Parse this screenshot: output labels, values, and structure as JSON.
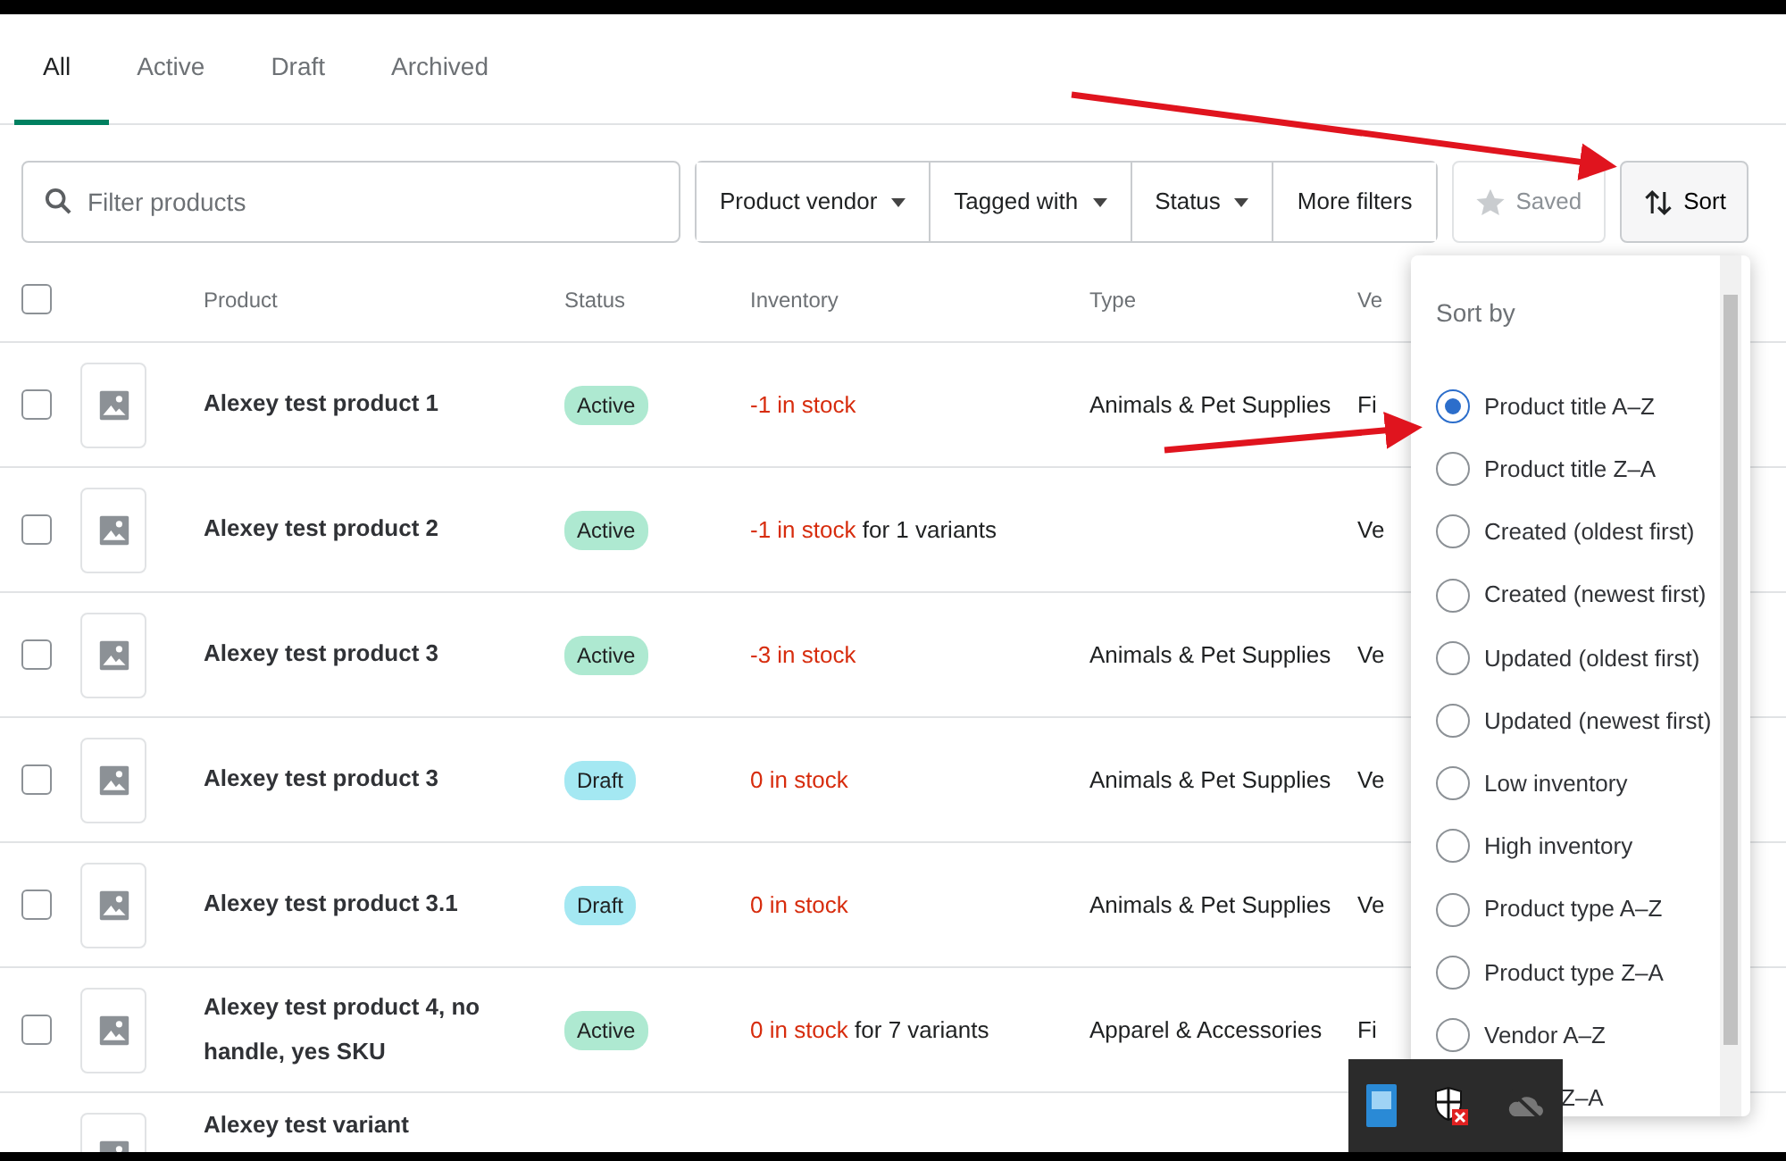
{
  "tabs": [
    {
      "label": "All",
      "selected": true
    },
    {
      "label": "Active",
      "selected": false
    },
    {
      "label": "Draft",
      "selected": false
    },
    {
      "label": "Archived",
      "selected": false
    }
  ],
  "search": {
    "placeholder": "Filter products"
  },
  "filters": [
    {
      "label": "Product vendor",
      "dropdown": true
    },
    {
      "label": "Tagged with",
      "dropdown": true
    },
    {
      "label": "Status",
      "dropdown": true
    },
    {
      "label": "More filters",
      "dropdown": false
    }
  ],
  "saved_button": {
    "label": "Saved",
    "disabled": true
  },
  "sort_button": {
    "label": "Sort"
  },
  "table": {
    "select_all_checked": false,
    "columns": [
      "Product",
      "Status",
      "Inventory",
      "Type",
      "Ve"
    ],
    "rows": [
      {
        "checked": false,
        "title": "Alexey test product 1",
        "status": {
          "label": "Active",
          "kind": "active"
        },
        "stock": "-1 in stock",
        "stock_note": "",
        "type": "Animals & Pet Supplies",
        "vendor": "Fi"
      },
      {
        "checked": false,
        "title": "Alexey test product 2",
        "status": {
          "label": "Active",
          "kind": "active"
        },
        "stock": "-1 in stock",
        "stock_note": "for 1 variants",
        "type": "",
        "vendor": "Ve"
      },
      {
        "checked": false,
        "title": "Alexey test product 3",
        "status": {
          "label": "Active",
          "kind": "active"
        },
        "stock": "-3 in stock",
        "stock_note": "",
        "type": "Animals & Pet Supplies",
        "vendor": "Ve"
      },
      {
        "checked": false,
        "title": "Alexey test product 3",
        "status": {
          "label": "Draft",
          "kind": "draft"
        },
        "stock": "0 in stock",
        "stock_note": "",
        "type": "Animals & Pet Supplies",
        "vendor": "Ve"
      },
      {
        "checked": false,
        "title": "Alexey test product 3.1",
        "status": {
          "label": "Draft",
          "kind": "draft"
        },
        "stock": "0 in stock",
        "stock_note": "",
        "type": "Animals & Pet Supplies",
        "vendor": "Ve"
      },
      {
        "checked": false,
        "title": "Alexey test product 4, no handle, yes SKU",
        "status": {
          "label": "Active",
          "kind": "active"
        },
        "stock": "0 in stock",
        "stock_note": "for 7 variants",
        "type": "Apparel & Accessories",
        "vendor": "Fi"
      },
      {
        "title": "Alexey test variant"
      }
    ]
  },
  "sort_menu": {
    "heading": "Sort by",
    "options": [
      {
        "label": "Product title A–Z",
        "selected": true
      },
      {
        "label": "Product title Z–A",
        "selected": false
      },
      {
        "label": "Created (oldest first)",
        "selected": false
      },
      {
        "label": "Created (newest first)",
        "selected": false
      },
      {
        "label": "Updated (oldest first)",
        "selected": false
      },
      {
        "label": "Updated (newest first)",
        "selected": false
      },
      {
        "label": "Low inventory",
        "selected": false
      },
      {
        "label": "High inventory",
        "selected": false
      },
      {
        "label": "Product type A–Z",
        "selected": false
      },
      {
        "label": "Product type Z–A",
        "selected": false
      },
      {
        "label": "Vendor A–Z",
        "selected": false
      },
      {
        "label": "Z–A",
        "kind": "covered"
      }
    ]
  }
}
